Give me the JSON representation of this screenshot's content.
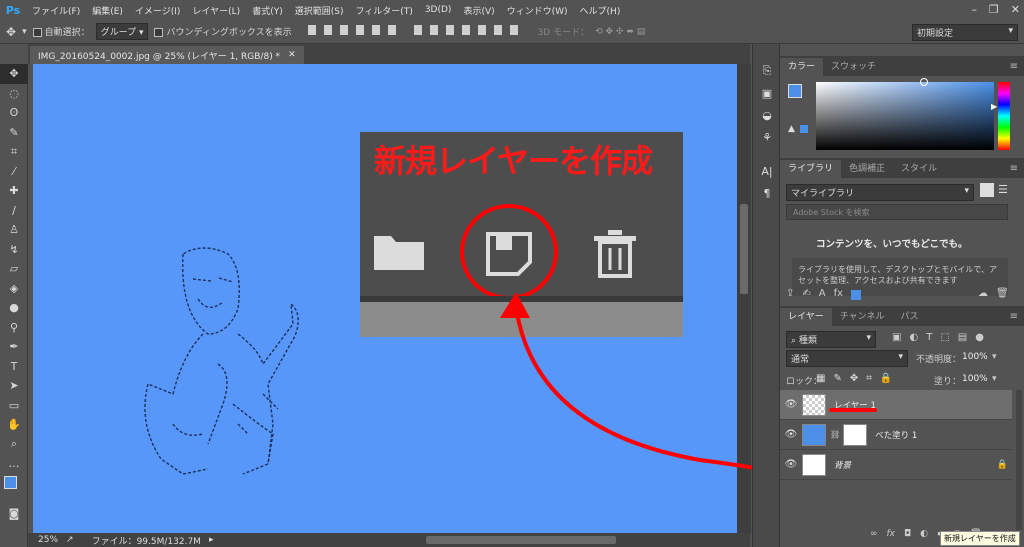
{
  "app": {
    "logo": "Ps"
  },
  "menu": [
    "ファイル(F)",
    "編集(E)",
    "イメージ(I)",
    "レイヤー(L)",
    "書式(Y)",
    "選択範囲(S)",
    "フィルター(T)",
    "3D(D)",
    "表示(V)",
    "ウィンドウ(W)",
    "ヘルプ(H)"
  ],
  "options_bar": {
    "auto_select_label": "自動選択：",
    "auto_select_value": "グループ",
    "bbox_label": "バウンディングボックスを表示",
    "mode3d_label": "3D モード：",
    "workspace": "初期設定"
  },
  "document": {
    "tab_title": "IMG_20160524_0002.jpg @ 25% (レイヤー 1, RGB/8) *",
    "canvas_color": "#5797fa"
  },
  "status": {
    "zoom": "25%",
    "file_info": "ファイル：99.5M/132.7M"
  },
  "callout": {
    "title": "新規レイヤーを作成"
  },
  "color_panel": {
    "tabs": [
      "カラー",
      "スウォッチ"
    ],
    "fg_color": "#4b8fe8"
  },
  "libraries_panel": {
    "tabs": [
      "ライブラリ",
      "色調補正",
      "スタイル"
    ],
    "dropdown": "マイライブラリ",
    "search_placeholder": "Adobe Stock を検索",
    "headline": "コンテンツを、いつでもどこでも。",
    "body": "ライブラリを使用して、デスクトップとモバイルで、アセットを整理、アクセスおよび共有できます"
  },
  "layers_panel": {
    "tabs": [
      "レイヤー",
      "チャンネル",
      "パス"
    ],
    "filter_label": "種類",
    "blend_mode": "通常",
    "opacity_label": "不透明度：",
    "opacity": "100%",
    "lock_label": "ロック：",
    "fill_label": "塗り：",
    "fill": "100%",
    "layers": [
      {
        "name": "レイヤー 1"
      },
      {
        "name": "べた塗り 1"
      },
      {
        "name": "背景"
      }
    ],
    "footer_fx": "fx"
  },
  "tooltip": "新規レイヤーを作成"
}
